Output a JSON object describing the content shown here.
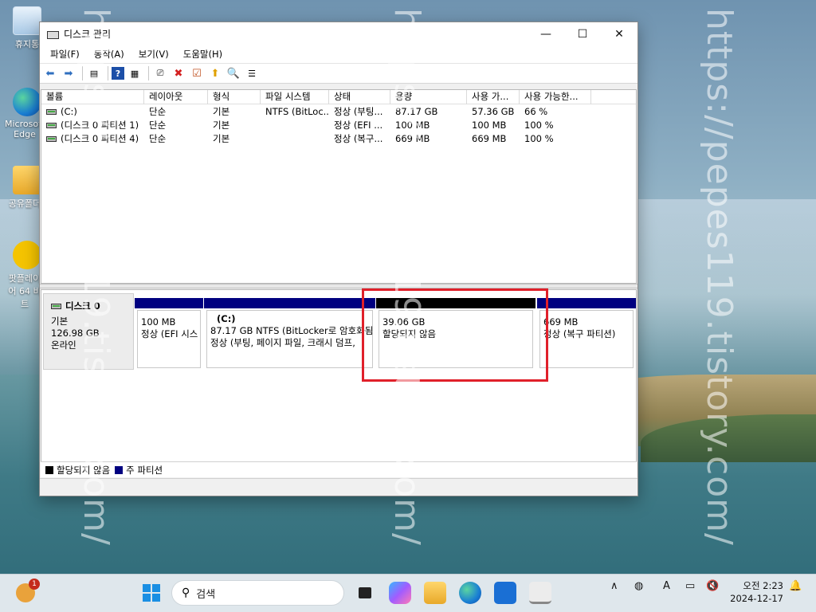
{
  "desktop": {
    "icons": [
      {
        "label": "휴지통"
      },
      {
        "label": "Microsoft Edge"
      },
      {
        "label": "공유폴더"
      },
      {
        "label": "팟플레이어 64 비트"
      }
    ]
  },
  "watermark": "https://pepes119.tistory.com/",
  "window": {
    "title": "디스크 관리",
    "controls": {
      "minimize": "—",
      "maximize": "☐",
      "close": "✕"
    },
    "menu": [
      "파일(F)",
      "동작(A)",
      "보기(V)",
      "도움말(H)"
    ]
  },
  "volume_list": {
    "columns": [
      "볼륨",
      "레이아웃",
      "형식",
      "파일 시스템",
      "상태",
      "용량",
      "사용 가...",
      "사용 가능한..."
    ],
    "rows": [
      [
        "(C:)",
        "단순",
        "기본",
        "NTFS (BitLoc...",
        "정상 (부팅...",
        "87.17 GB",
        "57.36 GB",
        "66 %"
      ],
      [
        "(디스크 0 파티션 1)",
        "단순",
        "기본",
        "",
        "정상 (EFI ...",
        "100 MB",
        "100 MB",
        "100 %"
      ],
      [
        "(디스크 0 파티션 4)",
        "단순",
        "기본",
        "",
        "정상 (복구...",
        "669 MB",
        "669 MB",
        "100 %"
      ]
    ]
  },
  "disk": {
    "name": "디스크 0",
    "type": "기본",
    "size": "126.98 GB",
    "status": "온라인",
    "partitions": [
      {
        "line1": "100 MB",
        "line2": "정상 (EFI 시스",
        "label": ""
      },
      {
        "label": "(C:)",
        "line1": "87.17 GB NTFS (BitLocker로 암호화됨",
        "line2": "정상 (부팅, 페이지 파일, 크래시 덤프,"
      },
      {
        "label": "",
        "line1": "39.06 GB",
        "line2": "할당되지 않음"
      },
      {
        "label": "",
        "line1": "669 MB",
        "line2": "정상 (복구 파티션)"
      }
    ]
  },
  "legend": [
    {
      "label": "할당되지 않음",
      "color": "#000000"
    },
    {
      "label": "주 파티션",
      "color": "#000080"
    }
  ],
  "taskbar": {
    "search_placeholder": "검색",
    "notification_count": "1",
    "clock_time": "오전 2:23",
    "clock_date": "2024-12-17",
    "tray_ime": "A"
  }
}
